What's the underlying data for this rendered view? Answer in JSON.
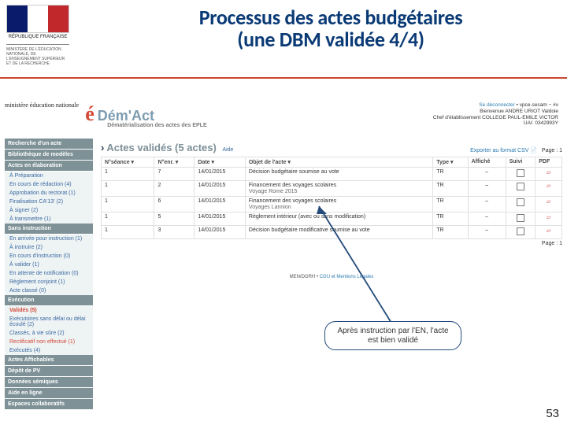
{
  "title": {
    "line1": "Processus des actes budgétaires",
    "line2": "(une DBM validée 4/4)"
  },
  "logo": {
    "rf": "RÉPUBLIQUE FRANÇAISE",
    "mini": "MINISTÈRE DE L'ÉDUCATION NATIONALE, DE L'ENSEIGNEMENT SUPÉRIEUR ET DE LA RECHERCHE"
  },
  "page_number": "53",
  "app_header": {
    "brand": "Dém'Act",
    "brand_sub": "Dématérialisation des actes des EPLE",
    "ministere": "ministère\néducation\nnationale",
    "logout": "Se déconnecter",
    "env": "vpce-secam − #v",
    "user_line1": "Bienvenue ANDRE URIOT Valdoie",
    "user_line2": "Chef d'établissement COLLEGE PAUL-EMILE VICTOR",
    "user_line3": "UAI: 0342993Y"
  },
  "sidebar": {
    "s1": "Recherche d'un acte",
    "s2": "Bibliothèque de modèles",
    "s3": "Actes en élaboration",
    "s3_items": [
      "À Préparation",
      "En cours de rédaction (4)",
      "Approbation du rectorat (1)",
      "Finalisation CA'13' (2)",
      "À signer (2)",
      "À transmettre (1)"
    ],
    "s4": "Sans instruction",
    "s4_items": [
      "En arrivée pour instruction (1)",
      "À instruire (2)",
      "En cours d'instruction (0)",
      "À valider (1)",
      "En attente de notification (0)",
      "Règlement conjoint (1)",
      "Acte classé (0)"
    ],
    "s5": "Exécution",
    "s5_head": "Validés (5)",
    "s5_items": [
      "Exécutoires sans délai ou délai écoulé (2)",
      "Classés, à vie sûre (2)",
      "Rectificatif non effectué (1)",
      "Exécutés (4)"
    ],
    "s6": "Actes Affichables",
    "s7": "Dépôt de PV",
    "s8": "Données sémiques",
    "s9": "Aide en ligne",
    "s10": "Espaces collaboratifs"
  },
  "section": {
    "heading": "Actes validés (5 actes)",
    "aide": "Aide",
    "pager": "Page : 1",
    "export": "Exporter au format CSV",
    "export_icon": "📄"
  },
  "table": {
    "cols": [
      "N°séance ▾",
      "N°enr. ▾",
      "Date ▾",
      "Objet de l'acte ▾",
      "Type ▾",
      "Affiché",
      "Suivi",
      "PDF"
    ],
    "rows": [
      {
        "seance": "1",
        "enr": "7",
        "date": "14/01/2015",
        "objet": "Décision budgétaire soumise au vote",
        "type": "TR",
        "aff": "–"
      },
      {
        "seance": "1",
        "enr": "2",
        "date": "14/01/2015",
        "objet": "Financement des voyages scolaires",
        "sub": "Voyage Rome 2015",
        "type": "TR",
        "aff": "–"
      },
      {
        "seance": "1",
        "enr": "6",
        "date": "14/01/2015",
        "objet": "Financement des voyages scolaires",
        "sub": "Voyages Lannion",
        "type": "TR",
        "aff": "–"
      },
      {
        "seance": "1",
        "enr": "5",
        "date": "14/01/2015",
        "objet": "Règlement intérieur (avec ou sans modification)",
        "type": "TR",
        "aff": "–"
      },
      {
        "seance": "1",
        "enr": "3",
        "date": "14/01/2015",
        "objet": "Décision budgétaire modificative soumise au vote",
        "type": "TR",
        "aff": "–"
      }
    ]
  },
  "footer": {
    "m": "MEN/DGRH • ",
    "link": "CGU et Mentions Légales"
  },
  "note": "Après instruction par l'EN, l'acte est bien validé"
}
